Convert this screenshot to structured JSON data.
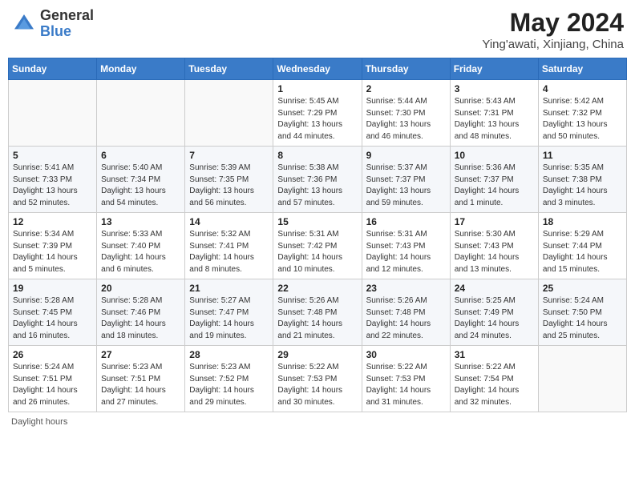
{
  "header": {
    "logo_general": "General",
    "logo_blue": "Blue",
    "month_year": "May 2024",
    "location": "Ying'awati, Xinjiang, China"
  },
  "days_of_week": [
    "Sunday",
    "Monday",
    "Tuesday",
    "Wednesday",
    "Thursday",
    "Friday",
    "Saturday"
  ],
  "footer": {
    "daylight_label": "Daylight hours"
  },
  "weeks": [
    {
      "days": [
        {
          "num": "",
          "info": ""
        },
        {
          "num": "",
          "info": ""
        },
        {
          "num": "",
          "info": ""
        },
        {
          "num": "1",
          "info": "Sunrise: 5:45 AM\nSunset: 7:29 PM\nDaylight: 13 hours\nand 44 minutes."
        },
        {
          "num": "2",
          "info": "Sunrise: 5:44 AM\nSunset: 7:30 PM\nDaylight: 13 hours\nand 46 minutes."
        },
        {
          "num": "3",
          "info": "Sunrise: 5:43 AM\nSunset: 7:31 PM\nDaylight: 13 hours\nand 48 minutes."
        },
        {
          "num": "4",
          "info": "Sunrise: 5:42 AM\nSunset: 7:32 PM\nDaylight: 13 hours\nand 50 minutes."
        }
      ]
    },
    {
      "days": [
        {
          "num": "5",
          "info": "Sunrise: 5:41 AM\nSunset: 7:33 PM\nDaylight: 13 hours\nand 52 minutes."
        },
        {
          "num": "6",
          "info": "Sunrise: 5:40 AM\nSunset: 7:34 PM\nDaylight: 13 hours\nand 54 minutes."
        },
        {
          "num": "7",
          "info": "Sunrise: 5:39 AM\nSunset: 7:35 PM\nDaylight: 13 hours\nand 56 minutes."
        },
        {
          "num": "8",
          "info": "Sunrise: 5:38 AM\nSunset: 7:36 PM\nDaylight: 13 hours\nand 57 minutes."
        },
        {
          "num": "9",
          "info": "Sunrise: 5:37 AM\nSunset: 7:37 PM\nDaylight: 13 hours\nand 59 minutes."
        },
        {
          "num": "10",
          "info": "Sunrise: 5:36 AM\nSunset: 7:37 PM\nDaylight: 14 hours\nand 1 minute."
        },
        {
          "num": "11",
          "info": "Sunrise: 5:35 AM\nSunset: 7:38 PM\nDaylight: 14 hours\nand 3 minutes."
        }
      ]
    },
    {
      "days": [
        {
          "num": "12",
          "info": "Sunrise: 5:34 AM\nSunset: 7:39 PM\nDaylight: 14 hours\nand 5 minutes."
        },
        {
          "num": "13",
          "info": "Sunrise: 5:33 AM\nSunset: 7:40 PM\nDaylight: 14 hours\nand 6 minutes."
        },
        {
          "num": "14",
          "info": "Sunrise: 5:32 AM\nSunset: 7:41 PM\nDaylight: 14 hours\nand 8 minutes."
        },
        {
          "num": "15",
          "info": "Sunrise: 5:31 AM\nSunset: 7:42 PM\nDaylight: 14 hours\nand 10 minutes."
        },
        {
          "num": "16",
          "info": "Sunrise: 5:31 AM\nSunset: 7:43 PM\nDaylight: 14 hours\nand 12 minutes."
        },
        {
          "num": "17",
          "info": "Sunrise: 5:30 AM\nSunset: 7:43 PM\nDaylight: 14 hours\nand 13 minutes."
        },
        {
          "num": "18",
          "info": "Sunrise: 5:29 AM\nSunset: 7:44 PM\nDaylight: 14 hours\nand 15 minutes."
        }
      ]
    },
    {
      "days": [
        {
          "num": "19",
          "info": "Sunrise: 5:28 AM\nSunset: 7:45 PM\nDaylight: 14 hours\nand 16 minutes."
        },
        {
          "num": "20",
          "info": "Sunrise: 5:28 AM\nSunset: 7:46 PM\nDaylight: 14 hours\nand 18 minutes."
        },
        {
          "num": "21",
          "info": "Sunrise: 5:27 AM\nSunset: 7:47 PM\nDaylight: 14 hours\nand 19 minutes."
        },
        {
          "num": "22",
          "info": "Sunrise: 5:26 AM\nSunset: 7:48 PM\nDaylight: 14 hours\nand 21 minutes."
        },
        {
          "num": "23",
          "info": "Sunrise: 5:26 AM\nSunset: 7:48 PM\nDaylight: 14 hours\nand 22 minutes."
        },
        {
          "num": "24",
          "info": "Sunrise: 5:25 AM\nSunset: 7:49 PM\nDaylight: 14 hours\nand 24 minutes."
        },
        {
          "num": "25",
          "info": "Sunrise: 5:24 AM\nSunset: 7:50 PM\nDaylight: 14 hours\nand 25 minutes."
        }
      ]
    },
    {
      "days": [
        {
          "num": "26",
          "info": "Sunrise: 5:24 AM\nSunset: 7:51 PM\nDaylight: 14 hours\nand 26 minutes."
        },
        {
          "num": "27",
          "info": "Sunrise: 5:23 AM\nSunset: 7:51 PM\nDaylight: 14 hours\nand 27 minutes."
        },
        {
          "num": "28",
          "info": "Sunrise: 5:23 AM\nSunset: 7:52 PM\nDaylight: 14 hours\nand 29 minutes."
        },
        {
          "num": "29",
          "info": "Sunrise: 5:22 AM\nSunset: 7:53 PM\nDaylight: 14 hours\nand 30 minutes."
        },
        {
          "num": "30",
          "info": "Sunrise: 5:22 AM\nSunset: 7:53 PM\nDaylight: 14 hours\nand 31 minutes."
        },
        {
          "num": "31",
          "info": "Sunrise: 5:22 AM\nSunset: 7:54 PM\nDaylight: 14 hours\nand 32 minutes."
        },
        {
          "num": "",
          "info": ""
        }
      ]
    }
  ]
}
